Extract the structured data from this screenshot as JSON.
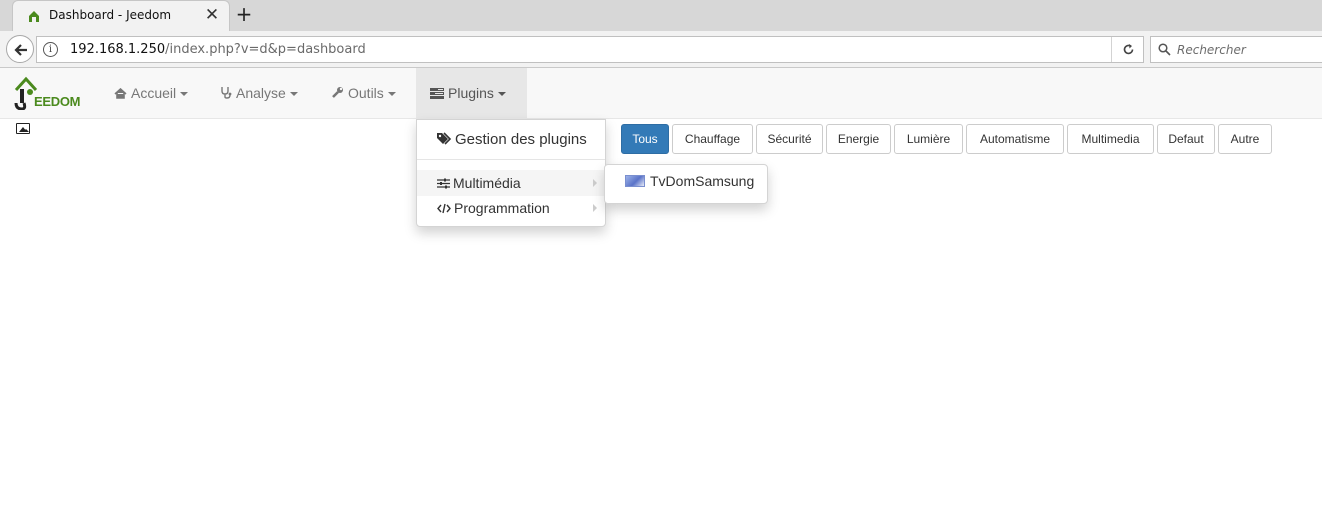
{
  "browser": {
    "tab_title": "Dashboard - Jeedom",
    "tab_close": "✕",
    "new_tab": "+",
    "url_host": "192.168.1.250",
    "url_path": "/index.php?v=d&p=dashboard",
    "search_placeholder": "Rechercher"
  },
  "app_nav": {
    "logo_text": "EEDOM",
    "items": [
      {
        "label": "Accueil",
        "icon": "home-icon"
      },
      {
        "label": "Analyse",
        "icon": "stethoscope-icon"
      },
      {
        "label": "Outils",
        "icon": "wrench-icon"
      },
      {
        "label": "Plugins",
        "icon": "tasks-icon",
        "active": true
      }
    ]
  },
  "plugins_menu": {
    "gestion": "Gestion des plugins",
    "multimedia": "Multimédia",
    "programmation": "Programmation",
    "submenu_item": "TvDomSamsung"
  },
  "filters": [
    "Tous",
    "Chauffage",
    "Sécurité",
    "Energie",
    "Lumière",
    "Automatisme",
    "Multimedia",
    "Defaut",
    "Autre"
  ],
  "colors": {
    "primary": "#337ab7",
    "jeedom_green": "#4b8a1e"
  }
}
